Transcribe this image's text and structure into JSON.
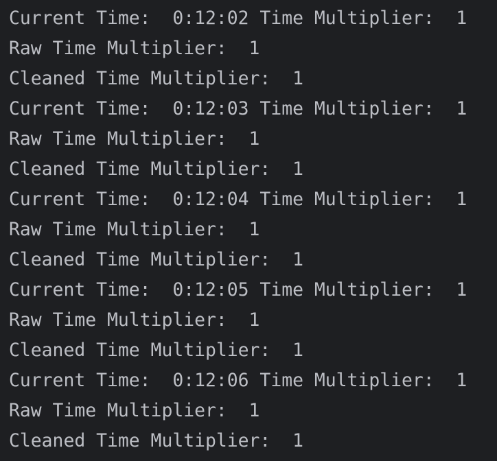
{
  "console": {
    "lines": [
      "Current Time:  0:12:02 Time Multiplier:  1",
      "Raw Time Multiplier:  1",
      "Cleaned Time Multiplier:  1",
      "Current Time:  0:12:03 Time Multiplier:  1",
      "Raw Time Multiplier:  1",
      "Cleaned Time Multiplier:  1",
      "Current Time:  0:12:04 Time Multiplier:  1",
      "Raw Time Multiplier:  1",
      "Cleaned Time Multiplier:  1",
      "Current Time:  0:12:05 Time Multiplier:  1",
      "Raw Time Multiplier:  1",
      "Cleaned Time Multiplier:  1",
      "Current Time:  0:12:06 Time Multiplier:  1",
      "Raw Time Multiplier:  1",
      "Cleaned Time Multiplier:  1"
    ]
  }
}
